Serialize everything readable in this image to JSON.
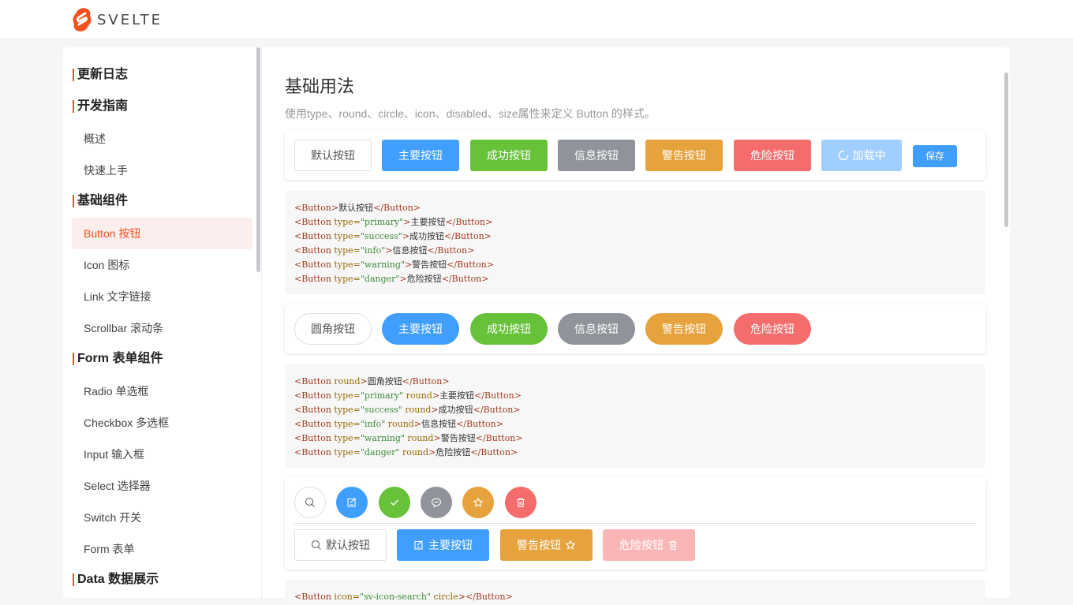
{
  "brand": {
    "name": "SVELTE",
    "color": "#f4511e"
  },
  "sidebar": {
    "groups": [
      {
        "label": "更新日志"
      },
      {
        "label": "开发指南"
      },
      {
        "label": "基础组件"
      },
      {
        "label": "Form 表单组件"
      },
      {
        "label": "Data 数据展示"
      }
    ],
    "items": [
      {
        "label": "概述"
      },
      {
        "label": "快速上手"
      },
      {
        "label": "Button 按钮"
      },
      {
        "label": "Icon 图标"
      },
      {
        "label": "Link 文字链接"
      },
      {
        "label": "Scrollbar 滚动条"
      },
      {
        "label": "Radio 单选框"
      },
      {
        "label": "Checkbox 多选框"
      },
      {
        "label": "Input 输入框"
      },
      {
        "label": "Select 选择器"
      },
      {
        "label": "Switch 开关"
      },
      {
        "label": "Form 表单"
      }
    ],
    "active_item": "Button 按钮"
  },
  "content": {
    "title": "基础用法",
    "description": "使用type、round、circle、icon、disabled、size属性来定义 Button 的样式。",
    "row1": {
      "default": "默认按钮",
      "primary": "主要按钮",
      "success": "成功按钮",
      "info": "信息按钮",
      "warning": "警告按钮",
      "danger": "危险按钮",
      "loading": "加载中",
      "save": "保存"
    },
    "row2": {
      "default": "圆角按钮",
      "primary": "主要按钮",
      "success": "成功按钮",
      "info": "信息按钮",
      "warning": "警告按钮",
      "danger": "危险按钮"
    },
    "row3": {
      "default": "默认按钮",
      "primary": "主要按钮",
      "warning": "警告按钮",
      "danger": "危险按钮"
    },
    "code1": [
      {
        "attrs": "",
        "attr_value": "",
        "text": "默认按钮"
      },
      {
        "attrs": " type=",
        "attr_value": "\"primary\"",
        "text": "主要按钮"
      },
      {
        "attrs": " type=",
        "attr_value": "\"success\"",
        "text": "成功按钮"
      },
      {
        "attrs": " type=",
        "attr_value": "\"info\"",
        "text": "信息按钮"
      },
      {
        "attrs": " type=",
        "attr_value": "\"warning\"",
        "text": "警告按钮"
      },
      {
        "attrs": " type=",
        "attr_value": "\"danger\"",
        "text": "危险按钮"
      }
    ],
    "code2": [
      {
        "pre": " round",
        "attr_value": "",
        "post": "",
        "text": "圆角按钮"
      },
      {
        "pre": " type=",
        "attr_value": "\"primary\"",
        "post": " round",
        "text": "主要按钮"
      },
      {
        "pre": " type=",
        "attr_value": "\"success\"",
        "post": " round",
        "text": "成功按钮"
      },
      {
        "pre": " type=",
        "attr_value": "\"info\"",
        "post": " round",
        "text": "信息按钮"
      },
      {
        "pre": " type=",
        "attr_value": "\"warning\"",
        "post": " round",
        "text": "警告按钮"
      },
      {
        "pre": " type=",
        "attr_value": "\"danger\"",
        "post": " round",
        "text": "危险按钮"
      }
    ],
    "code3_partial": {
      "pre": " icon=",
      "attr_value": "\"sv-icon-search\"",
      "post": " circle",
      "text": ""
    },
    "code_tag": "Button"
  },
  "colors": {
    "primary": "#409eff",
    "success": "#67c23a",
    "info": "#909399",
    "warning": "#e6a23c",
    "danger": "#f56c6c",
    "active_bg": "#fdeeee"
  }
}
